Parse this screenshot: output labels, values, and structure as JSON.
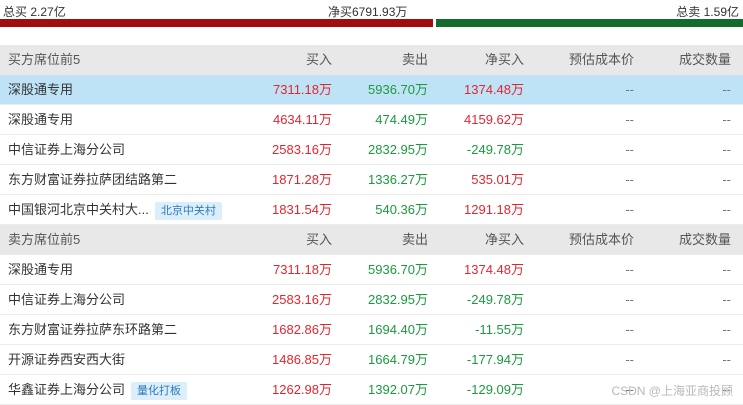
{
  "summary": {
    "total_buy": "总买 2.27亿",
    "net_buy": "净买6791.93万",
    "total_sell": "总卖 1.59亿"
  },
  "buy_table": {
    "headers": [
      "买方席位前5",
      "买入",
      "卖出",
      "净买入",
      "预估成本价",
      "成交数量"
    ],
    "rows": [
      {
        "name": "深股通专用",
        "tag": "",
        "buy": "7311.18万",
        "sell": "5936.70万",
        "net": "1374.48万",
        "cost": "--",
        "volume": "--"
      },
      {
        "name": "深股通专用",
        "tag": "",
        "buy": "4634.11万",
        "sell": "474.49万",
        "net": "4159.62万",
        "cost": "--",
        "volume": "--"
      },
      {
        "name": "中信证券上海分公司",
        "tag": "",
        "buy": "2583.16万",
        "sell": "2832.95万",
        "net": "-249.78万",
        "cost": "--",
        "volume": "--"
      },
      {
        "name": "东方财富证券拉萨团结路第二",
        "tag": "",
        "buy": "1871.28万",
        "sell": "1336.27万",
        "net": "535.01万",
        "cost": "--",
        "volume": "--"
      },
      {
        "name": "中国银河北京中关村大...",
        "tag": "北京中关村",
        "buy": "1831.54万",
        "sell": "540.36万",
        "net": "1291.18万",
        "cost": "--",
        "volume": "--"
      }
    ]
  },
  "sell_table": {
    "headers": [
      "卖方席位前5",
      "买入",
      "卖出",
      "净买入",
      "预估成本价",
      "成交数量"
    ],
    "rows": [
      {
        "name": "深股通专用",
        "tag": "",
        "buy": "7311.18万",
        "sell": "5936.70万",
        "net": "1374.48万",
        "cost": "--",
        "volume": "--"
      },
      {
        "name": "中信证券上海分公司",
        "tag": "",
        "buy": "2583.16万",
        "sell": "2832.95万",
        "net": "-249.78万",
        "cost": "--",
        "volume": "--"
      },
      {
        "name": "东方财富证券拉萨东环路第二",
        "tag": "",
        "buy": "1682.86万",
        "sell": "1694.40万",
        "net": "-11.55万",
        "cost": "--",
        "volume": "--"
      },
      {
        "name": "开源证券西安西大街",
        "tag": "",
        "buy": "1486.85万",
        "sell": "1664.79万",
        "net": "-177.94万",
        "cost": "--",
        "volume": "--"
      },
      {
        "name": "华鑫证券上海分公司",
        "tag": "量化打板",
        "buy": "1262.98万",
        "sell": "1392.07万",
        "net": "-129.09万",
        "cost": "--",
        "volume": "--"
      }
    ]
  },
  "watermark": "CSDN @上海亚商投顾",
  "colors": {
    "positive": "#e5252e",
    "negative": "#1a9b3d",
    "highlight": "#bfe3f6",
    "buy_bar": "#a30d0d",
    "sell_bar": "#136b2e"
  }
}
